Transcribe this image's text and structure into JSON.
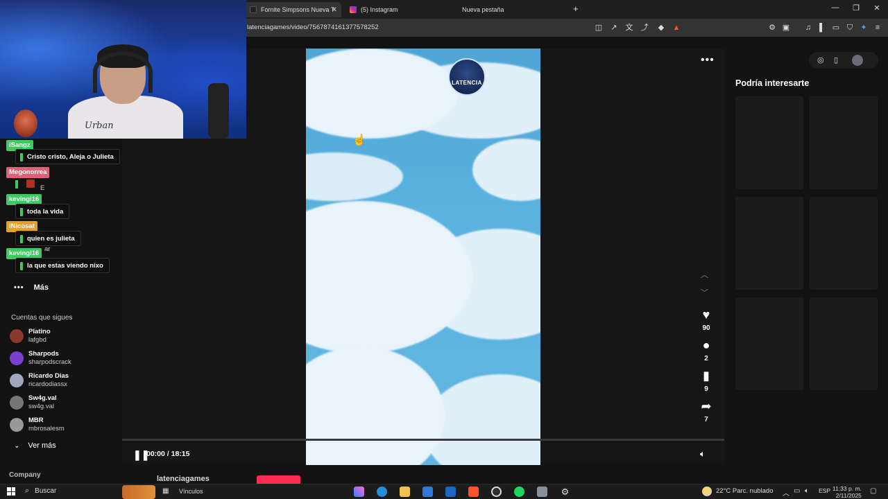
{
  "browser": {
    "tabs": [
      {
        "label": "Fornite Simpsons Nueva Tem",
        "active": true
      },
      {
        "label": "(5) Instagram",
        "active": false
      },
      {
        "label": "Nueva pestaña",
        "active": false
      }
    ],
    "url": "latenciagames/video/7567874161377578252"
  },
  "chat": [
    {
      "user": "iSangz",
      "color": "#3ccb5e",
      "message": "Cristo cristo, Aleja o Julieta"
    },
    {
      "user": "Megonorrea",
      "color": "#e0607a",
      "message": ""
    },
    {
      "user": "kevingi16",
      "color": "#3ccb5e",
      "message": "toda la vida"
    },
    {
      "user": "iNicosat",
      "color": "#e8a020",
      "message": "quien es julieta"
    },
    {
      "user": "kevingi16",
      "color": "#3ccb5e",
      "message": "la que estas viendo nixo"
    }
  ],
  "chat_ghost": {
    "letter_e": "E",
    "ar": "ar"
  },
  "webcam": {
    "shirt_text": "Urban"
  },
  "sidebar": {
    "more_label": "Más",
    "following_title": "Cuentas que sigues",
    "following": [
      {
        "name": "Platino",
        "handle": "lafgbd",
        "color": "#8a3a2a"
      },
      {
        "name": "Sharpods",
        "handle": "sharpodscrack",
        "color": "#7b3fd0"
      },
      {
        "name": "Ricardo Dias",
        "handle": "ricardodiassx",
        "color": "#a0a8c0"
      },
      {
        "name": "Sw4g.val",
        "handle": "sw4g.val",
        "color": "#777777"
      },
      {
        "name": "MBR",
        "handle": "mbrosalesm",
        "color": "#999999"
      }
    ],
    "see_more_label": "Ver más",
    "company_label": "Company"
  },
  "video": {
    "channel_logo_text": "LATENCIA",
    "likes": "90",
    "comments": "2",
    "saves": "9",
    "shares": "7",
    "timecode": "00:00 / 18:15",
    "progress": 0.0,
    "channel_name": "latenciagames"
  },
  "right_panel": {
    "title": "Podría interesarte"
  },
  "taskbar": {
    "search_label": "Buscar",
    "links_label": "Vínculos",
    "weather": "22°C  Parc. nublado",
    "language": "ESP",
    "time": "11:33 p. m.",
    "date": "2/11/2025"
  }
}
